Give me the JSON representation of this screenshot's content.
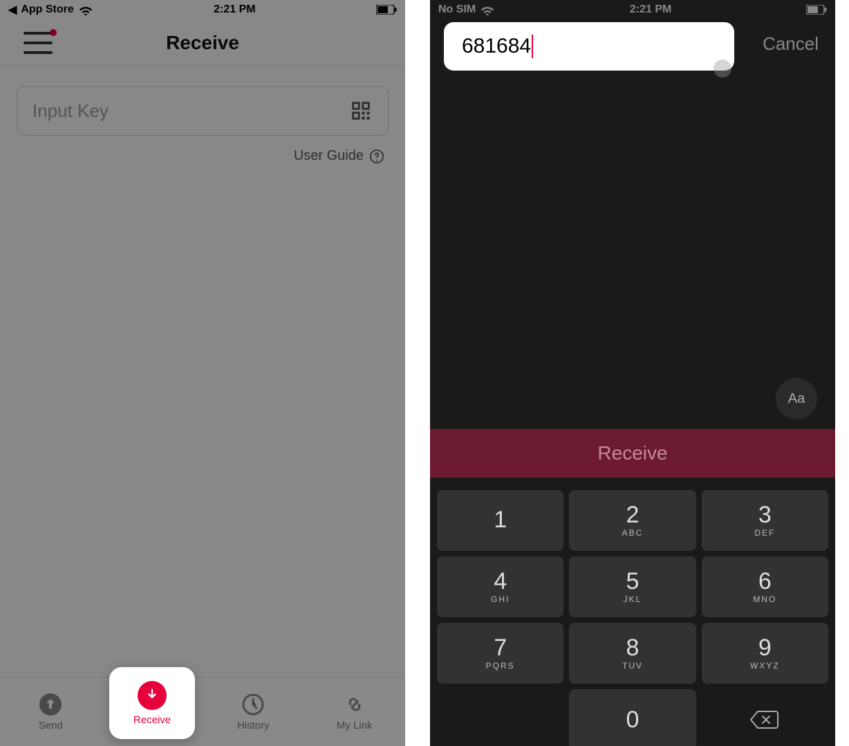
{
  "left": {
    "status": {
      "back": "App Store",
      "time": "2:21 PM"
    },
    "header": {
      "title": "Receive"
    },
    "input": {
      "placeholder": "Input Key"
    },
    "userGuide": "User Guide",
    "tabs": {
      "send": "Send",
      "receive": "Receive",
      "history": "History",
      "mylink": "My Link"
    }
  },
  "right": {
    "status": {
      "carrier": "No SIM",
      "time": "2:21 PM"
    },
    "input": {
      "value": "681684"
    },
    "cancel": "Cancel",
    "aa": "Aa",
    "receiveBtn": "Receive",
    "keys": [
      {
        "n": "1",
        "s": ""
      },
      {
        "n": "2",
        "s": "ABC"
      },
      {
        "n": "3",
        "s": "DEF"
      },
      {
        "n": "4",
        "s": "GHI"
      },
      {
        "n": "5",
        "s": "JKL"
      },
      {
        "n": "6",
        "s": "MNO"
      },
      {
        "n": "7",
        "s": "PQRS"
      },
      {
        "n": "8",
        "s": "TUV"
      },
      {
        "n": "9",
        "s": "WXYZ"
      },
      {
        "n": "",
        "s": ""
      },
      {
        "n": "0",
        "s": ""
      },
      {
        "n": "",
        "s": ""
      }
    ]
  }
}
